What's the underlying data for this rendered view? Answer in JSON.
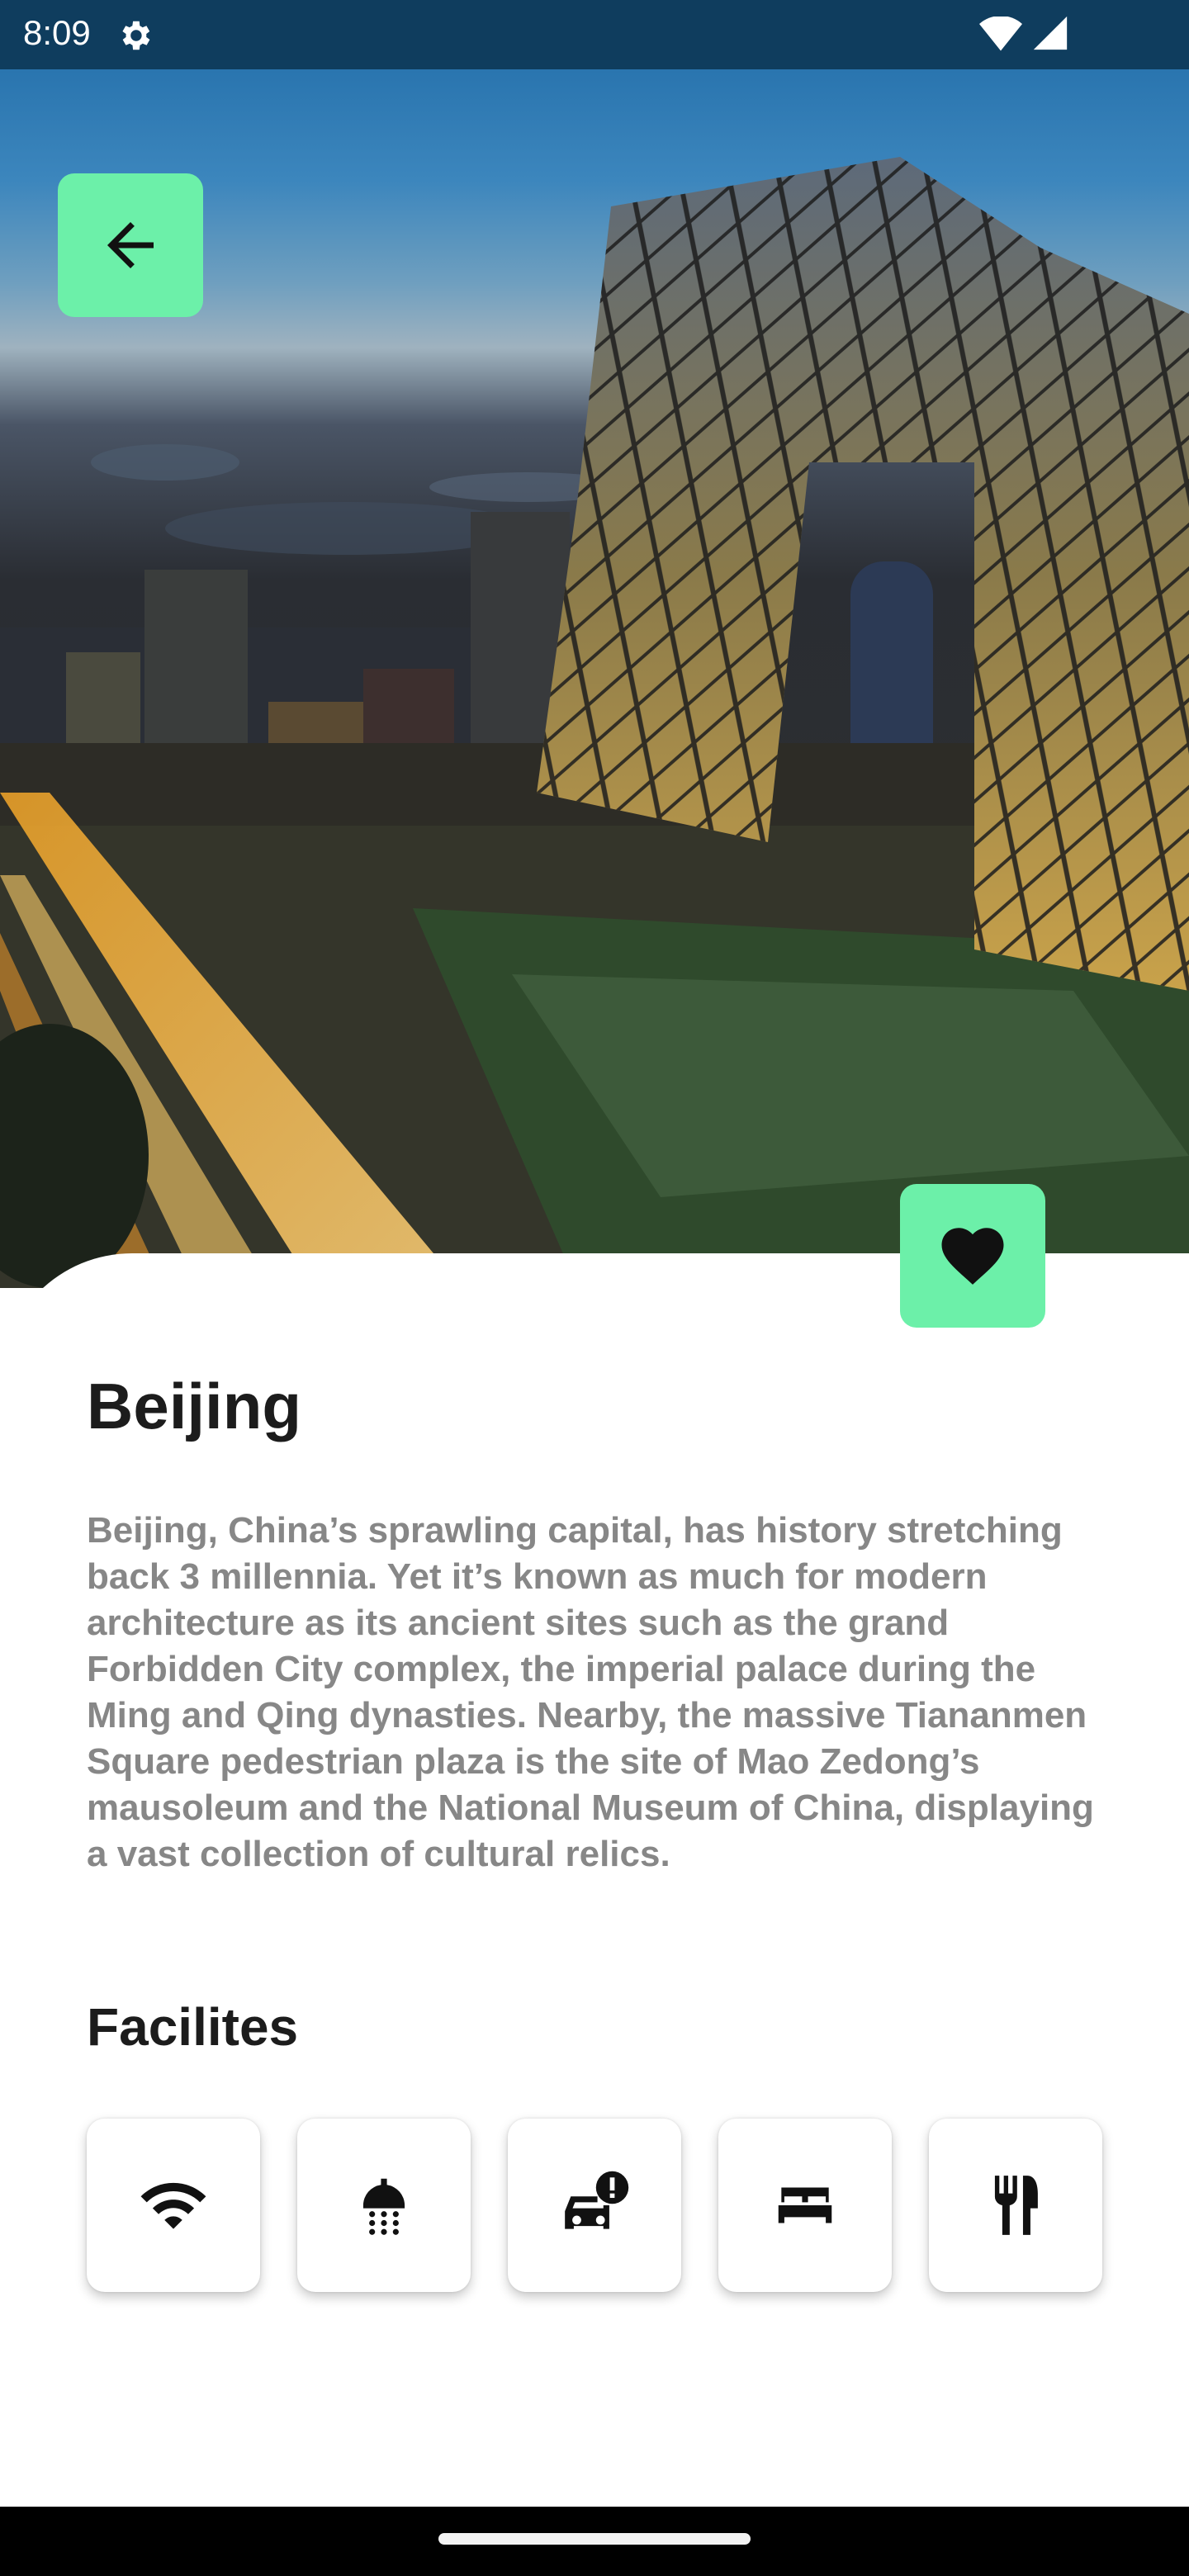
{
  "status_bar": {
    "time": "8:09",
    "icons": [
      "gear-icon",
      "wifi-icon",
      "signal-icon"
    ]
  },
  "hero": {
    "image": "beijing-cityscape-cctv-tower-at-dusk"
  },
  "actions": {
    "back_icon": "arrow-left-icon",
    "favorite_icon": "heart-icon"
  },
  "place": {
    "title": "Beijing",
    "description": "Beijing, China’s sprawling capital, has history stretching back 3 millennia. Yet it’s known as much for modern architecture as its ancient sites such as the grand Forbidden City complex, the imperial palace during the Ming and Qing dynasties. Nearby, the massive Tiananmen Square pedestrian plaza is the site of Mao Zedong’s mausoleum and the National Museum of China, displaying a vast collection of cultural relics."
  },
  "facilities": {
    "title": "Facilites",
    "items": [
      {
        "icon": "wifi-icon"
      },
      {
        "icon": "shower-icon"
      },
      {
        "icon": "car-alert-icon"
      },
      {
        "icon": "bed-icon"
      },
      {
        "icon": "restaurant-icon"
      }
    ]
  },
  "colors": {
    "accent": "#6cf0a9",
    "title_text": "#1c1c1c",
    "body_text": "#878787",
    "status_bar": "#0f3d5e"
  }
}
